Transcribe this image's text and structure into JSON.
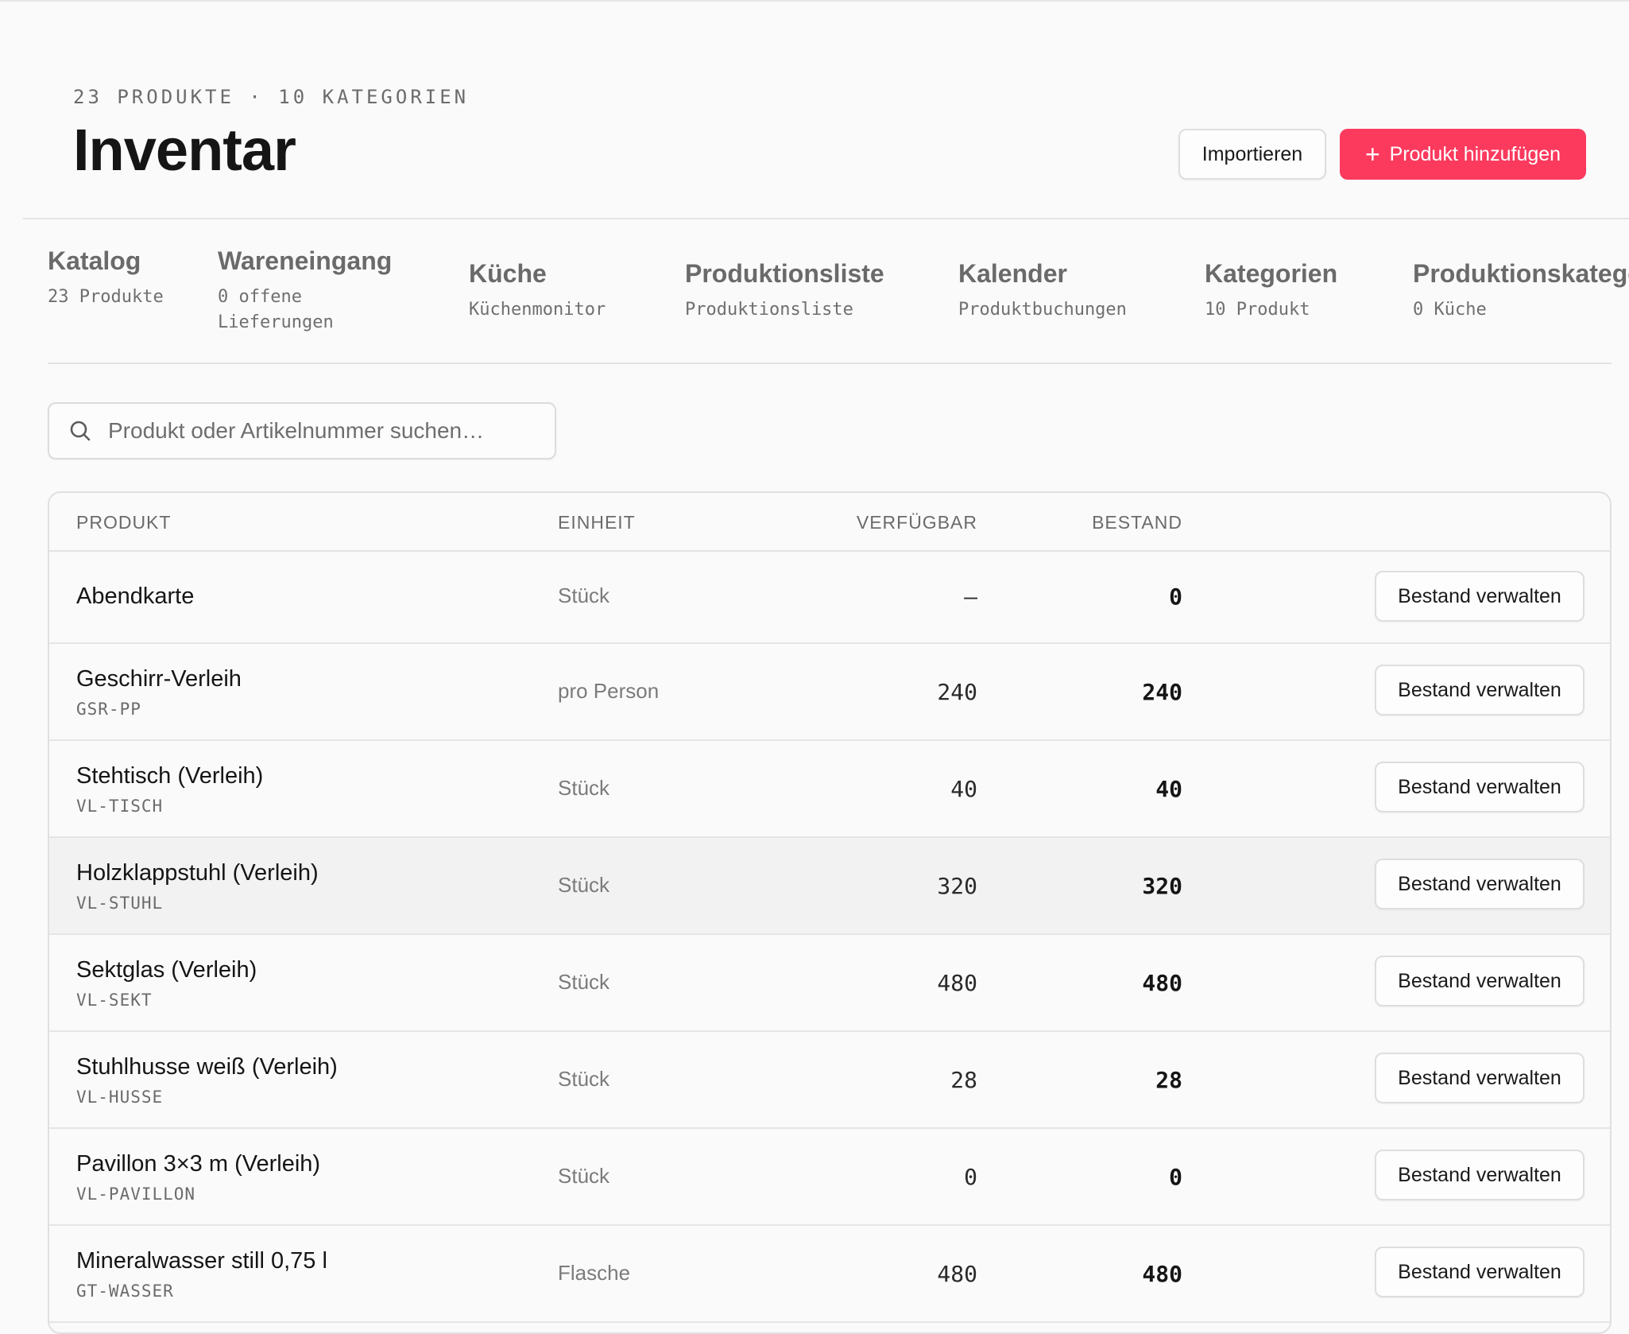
{
  "header": {
    "eyebrow": "23 PRODUKTE · 10 KATEGORIEN",
    "title": "Inventar",
    "import_label": "Importieren",
    "add_label": "Produkt hinzufügen",
    "add_icon": "+"
  },
  "tabs": [
    {
      "title": "Katalog",
      "subtitle": "23 Produkte"
    },
    {
      "title": "Wareneingang",
      "subtitle": "0 offene Lieferungen"
    },
    {
      "title": "Küche",
      "subtitle": "Küchenmonitor"
    },
    {
      "title": "Produktionsliste",
      "subtitle": "Produktionsliste"
    },
    {
      "title": "Kalender",
      "subtitle": "Produktbuchungen"
    },
    {
      "title": "Kategorien",
      "subtitle": "10 Produkt"
    },
    {
      "title": "Produktionskategorien",
      "subtitle": "0 Küche"
    }
  ],
  "search": {
    "placeholder": "Produkt oder Artikelnummer suchen…"
  },
  "table": {
    "columns": {
      "product": "PRODUKT",
      "unit": "EINHEIT",
      "available": "VERFÜGBAR",
      "stock": "BESTAND"
    },
    "action_label": "Bestand verwalten",
    "rows": [
      {
        "name": "Abendkarte",
        "sku": "",
        "unit": "Stück",
        "available": "—",
        "stock": "0"
      },
      {
        "name": "Geschirr-Verleih",
        "sku": "GSR-PP",
        "unit": "pro Person",
        "available": "240",
        "stock": "240"
      },
      {
        "name": "Stehtisch (Verleih)",
        "sku": "VL-TISCH",
        "unit": "Stück",
        "available": "40",
        "stock": "40"
      },
      {
        "name": "Holzklappstuhl (Verleih)",
        "sku": "VL-STUHL",
        "unit": "Stück",
        "available": "320",
        "stock": "320"
      },
      {
        "name": "Sektglas (Verleih)",
        "sku": "VL-SEKT",
        "unit": "Stück",
        "available": "480",
        "stock": "480"
      },
      {
        "name": "Stuhlhusse weiß (Verleih)",
        "sku": "VL-HUSSE",
        "unit": "Stück",
        "available": "28",
        "stock": "28"
      },
      {
        "name": "Pavillon 3×3 m (Verleih)",
        "sku": "VL-PAVILLON",
        "unit": "Stück",
        "available": "0",
        "stock": "0"
      },
      {
        "name": "Mineralwasser still 0,75 l",
        "sku": "GT-WASSER",
        "unit": "Flasche",
        "available": "480",
        "stock": "480"
      }
    ]
  },
  "colors": {
    "accent": "#fc3a5e",
    "background": "#fafafa",
    "row_highlight": "#f2f2f2"
  },
  "icons": {
    "search": "search-icon",
    "add": "plus-icon"
  }
}
